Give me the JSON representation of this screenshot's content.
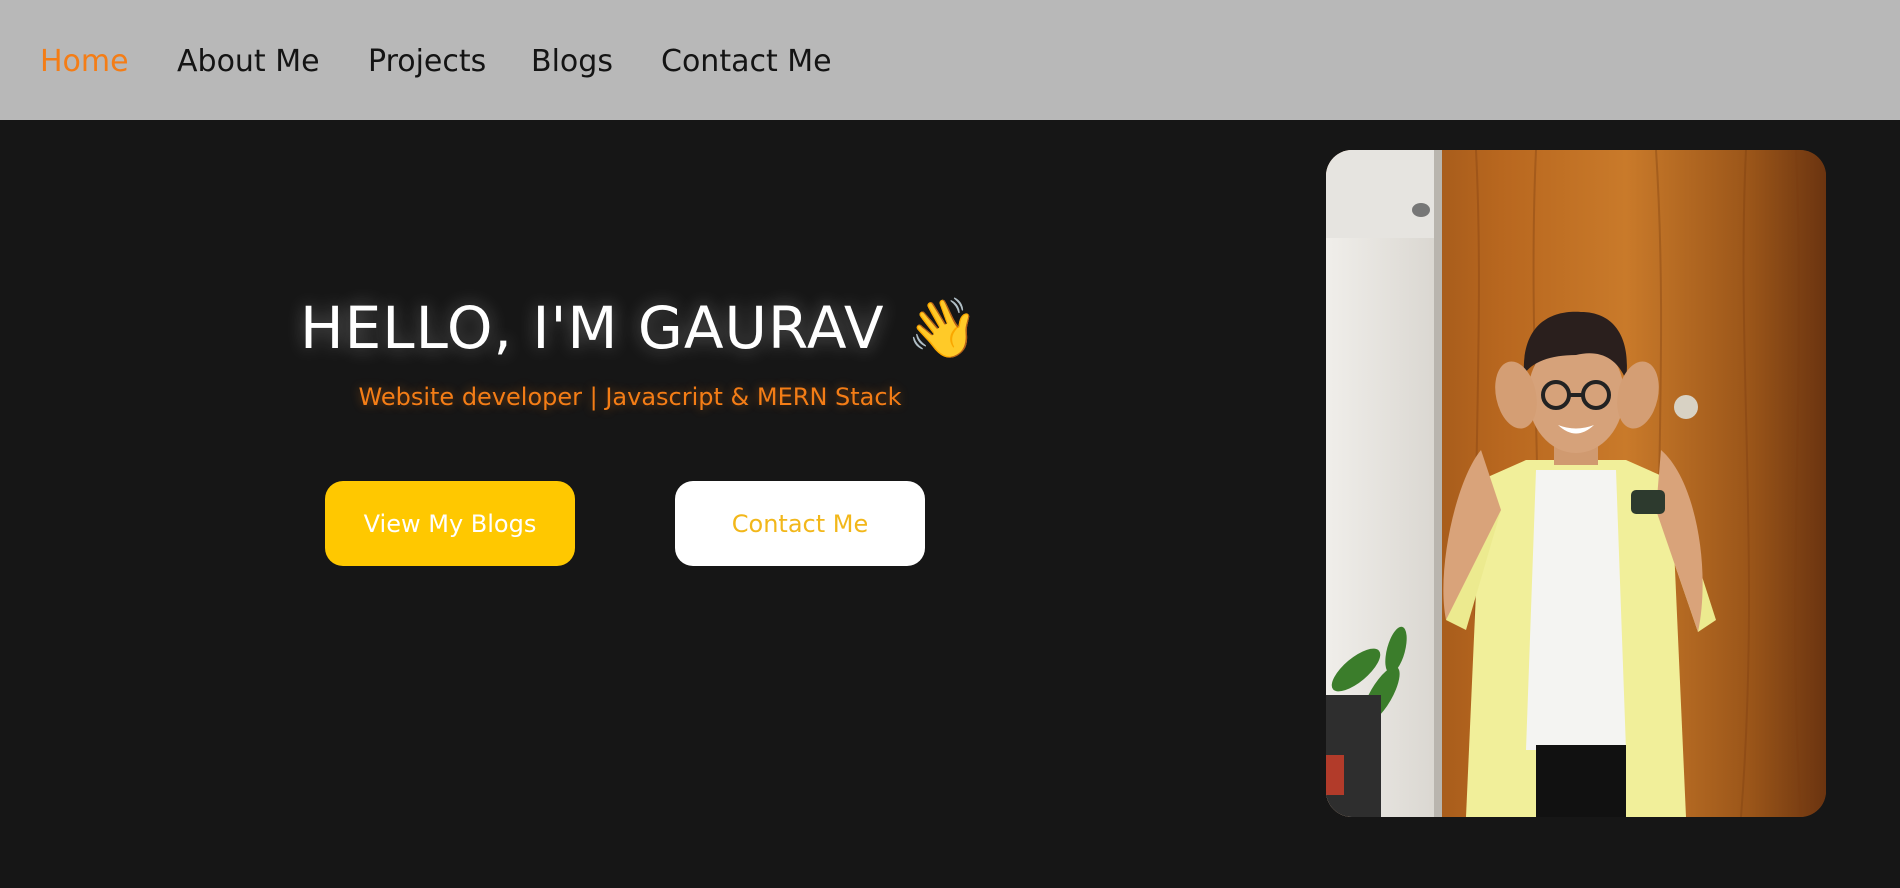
{
  "nav": {
    "items": [
      {
        "label": "Home",
        "active": true
      },
      {
        "label": "About Me",
        "active": false
      },
      {
        "label": "Projects",
        "active": false
      },
      {
        "label": "Blogs",
        "active": false
      },
      {
        "label": "Contact Me",
        "active": false
      }
    ]
  },
  "hero": {
    "greeting": "HELLO, I'M GAURAV",
    "wave_emoji": "👋",
    "subtitle": "Website developer | Javascript & MERN Stack",
    "primary_button": "View My Blogs",
    "secondary_button": "Contact Me"
  },
  "icons": {
    "wave": "waving-hand-icon"
  },
  "colors": {
    "nav_background": "#b8b8b8",
    "nav_active": "#f47d16",
    "hero_background": "#161616",
    "accent_orange": "#f47d16",
    "button_yellow": "#ffc800",
    "contact_text": "#f2b71a"
  }
}
